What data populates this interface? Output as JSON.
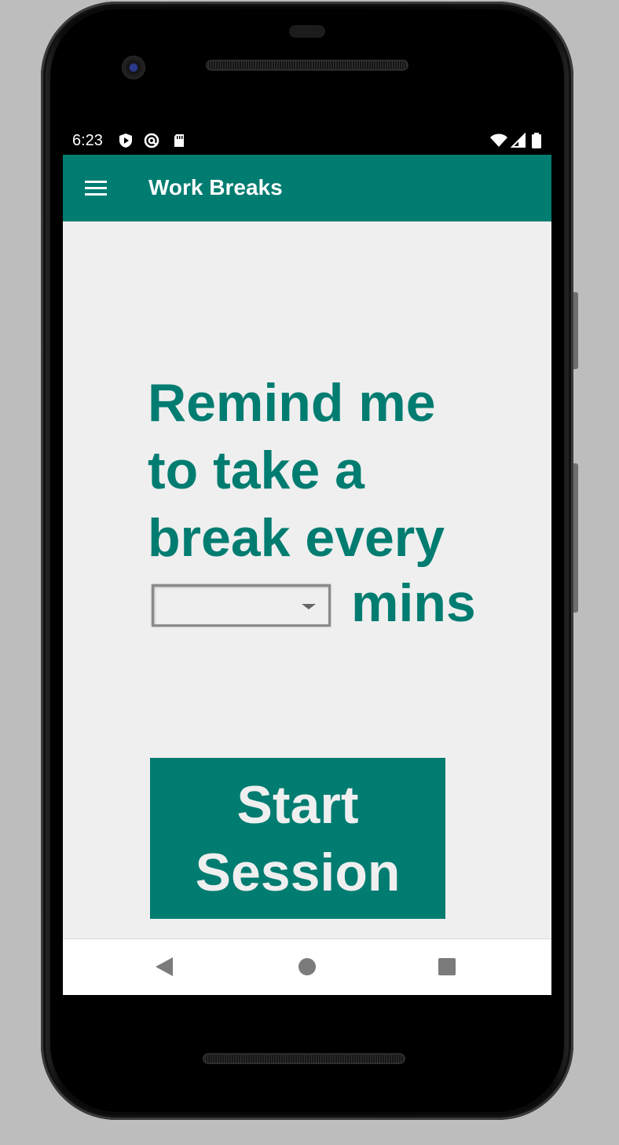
{
  "status_bar": {
    "time": "6:23",
    "left_icons": [
      "shield-play-icon",
      "at-sign-icon",
      "sd-card-icon"
    ],
    "right_icons": [
      "wifi-icon",
      "cell-signal-icon",
      "battery-icon"
    ]
  },
  "app_bar": {
    "title": "Work Breaks",
    "menu_icon": "hamburger-menu-icon",
    "background": "#007c71"
  },
  "main": {
    "prompt_lines": [
      "Remind me",
      "to take a",
      "break every"
    ],
    "interval_select": {
      "value": ""
    },
    "unit_label": "mins",
    "start_button": {
      "lines": [
        "Start",
        "Session"
      ]
    }
  },
  "nav_bar": {
    "icons": [
      "back-icon",
      "home-icon",
      "recents-icon"
    ]
  },
  "colors": {
    "accent": "#007c71",
    "content_background": "#efefef",
    "button_text": "#efefef"
  }
}
